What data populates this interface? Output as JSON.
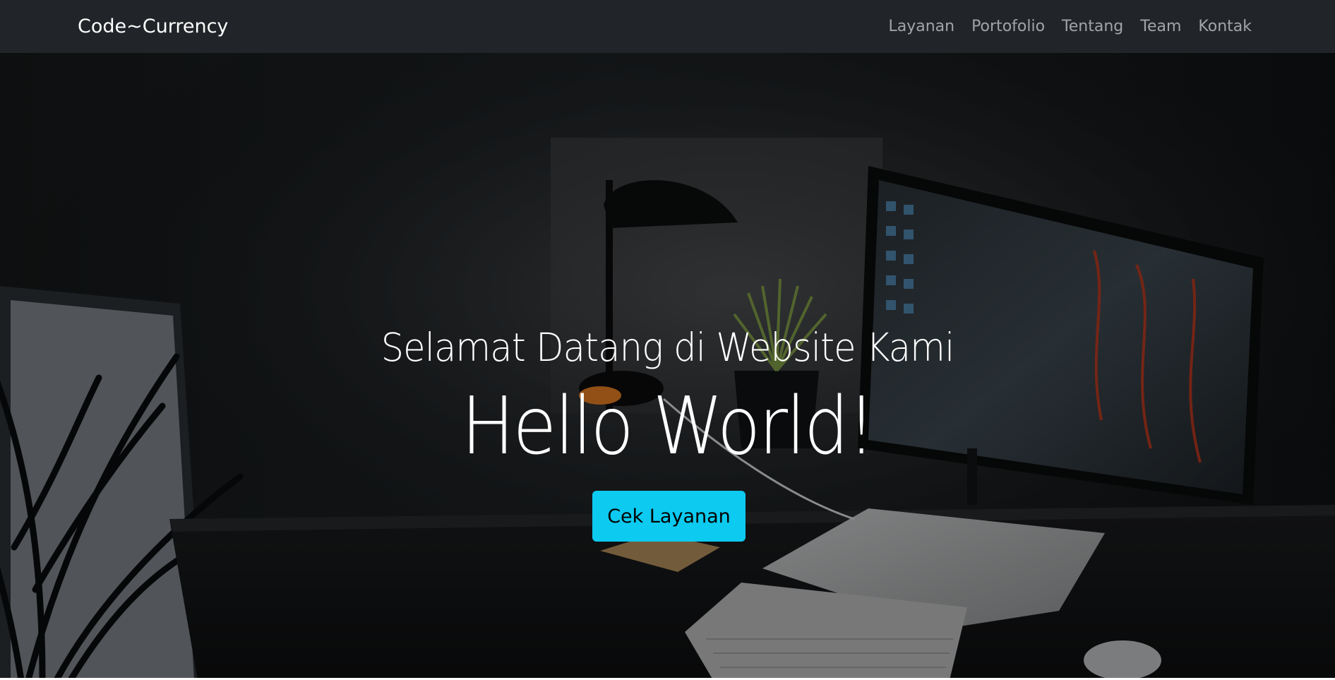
{
  "navbar": {
    "brand": "Code~Currency",
    "links": [
      "Layanan",
      "Portofolio",
      "Tentang",
      "Team",
      "Kontak"
    ]
  },
  "hero": {
    "subtitle": "Selamat Datang di Website Kami",
    "title": "Hello World!",
    "cta_label": "Cek Layanan"
  },
  "colors": {
    "navbar_bg": "#212529",
    "cta_bg": "#0dcaf0",
    "hero_text": "#ffffff"
  }
}
